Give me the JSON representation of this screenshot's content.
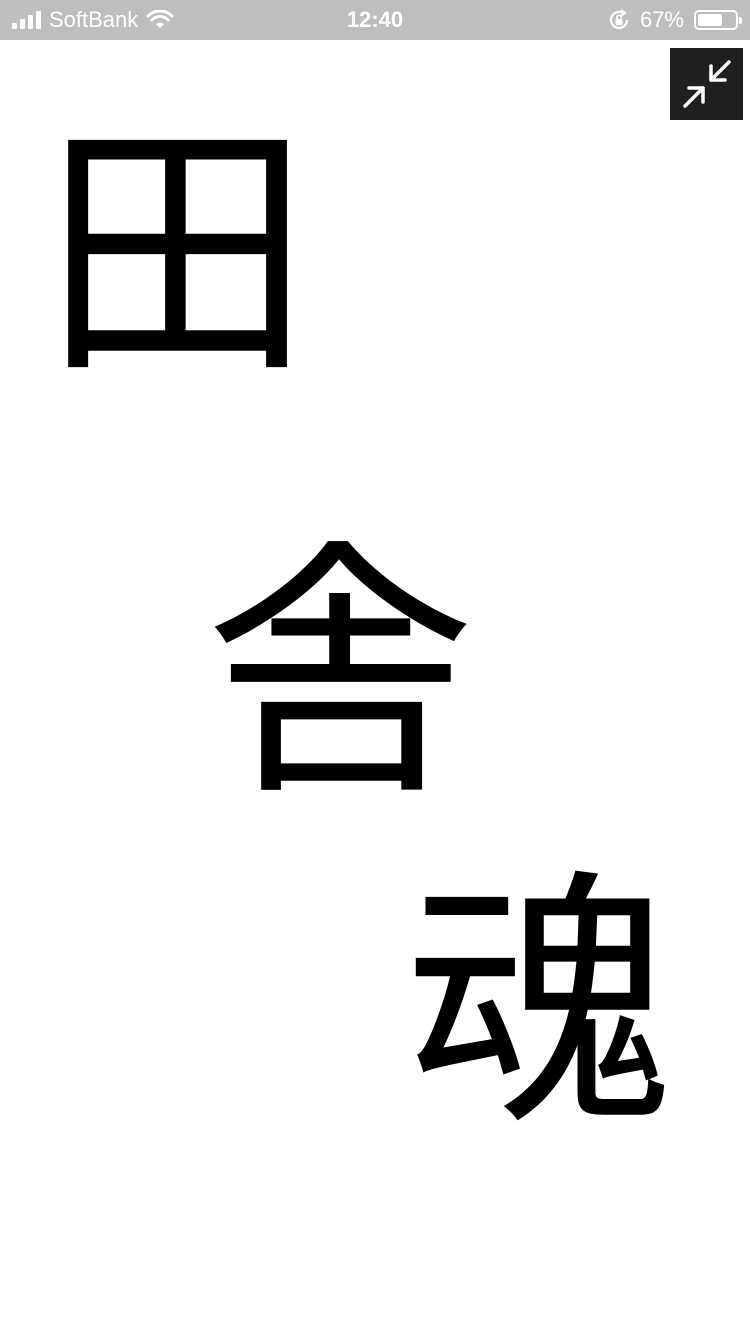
{
  "status_bar": {
    "carrier": "SoftBank",
    "time": "12:40",
    "battery_percent_label": "67%",
    "battery_level": 0.67
  },
  "toolbar": {
    "exit_fullscreen_icon": "compress-arrows-icon"
  },
  "content": {
    "characters": [
      "田",
      "舎",
      "魂"
    ]
  },
  "colors": {
    "status_bar_bg": "#bdbdbd",
    "button_bg": "#1f1f1f",
    "text": "#000000",
    "page_bg": "#ffffff"
  }
}
